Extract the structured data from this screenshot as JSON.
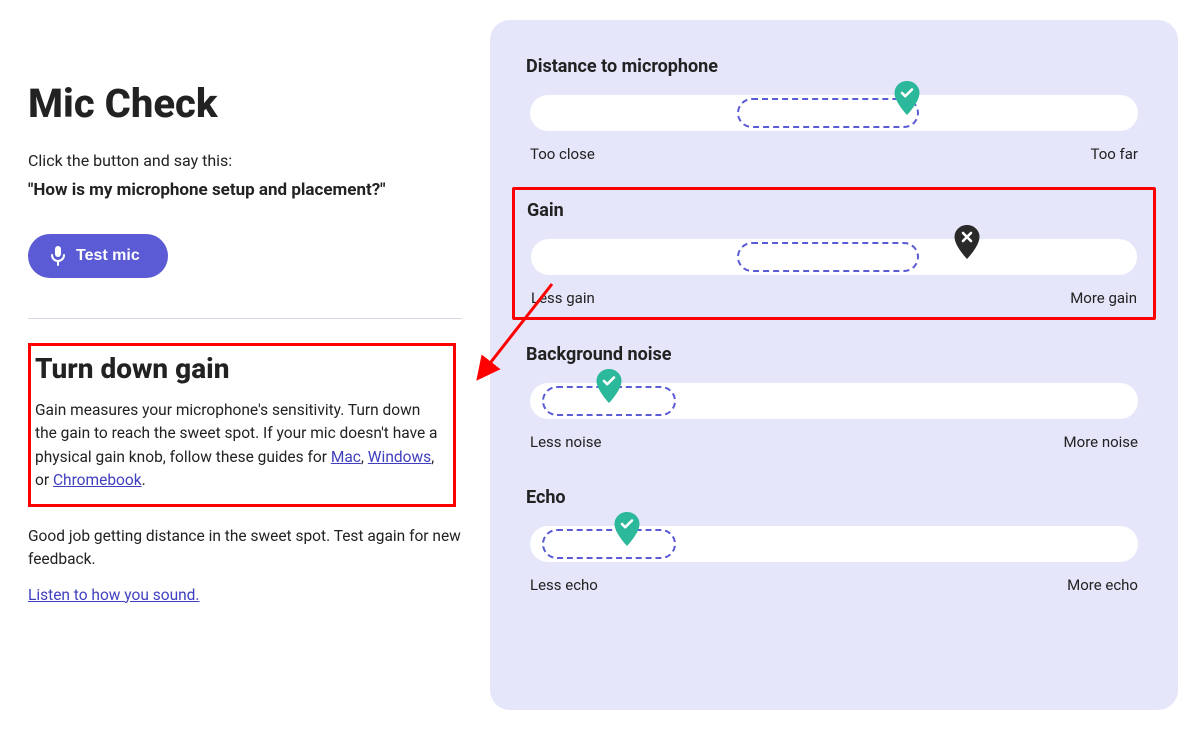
{
  "title": "Mic Check",
  "instruction": "Click the button and say this:",
  "prompt": "\"How is my microphone setup and placement?\"",
  "test_button": "Test mic",
  "advice": {
    "heading": "Turn down gain",
    "body_start": "Gain measures your microphone's sensitivity. Turn down the gain to reach the sweet spot. If your mic doesn't have a physical gain knob, follow these guides for ",
    "mac": "Mac",
    "sep1": ", ",
    "windows": "Windows",
    "sep2": ", or ",
    "chromebook": "Chromebook",
    "body_end": "."
  },
  "secondary": "Good job getting distance in the sweet spot. Test again for new feedback.",
  "listen_link": "Listen to how you sound.",
  "meters": {
    "distance": {
      "title": "Distance to microphone",
      "left": "Too close",
      "right": "Too far",
      "sweet_left_pct": 34,
      "sweet_width_pct": 30,
      "pin_pct": 62,
      "pin_state": "good"
    },
    "gain": {
      "title": "Gain",
      "left": "Less gain",
      "right": "More gain",
      "sweet_left_pct": 34,
      "sweet_width_pct": 30,
      "pin_pct": 72,
      "pin_state": "bad"
    },
    "noise": {
      "title": "Background noise",
      "left": "Less noise",
      "right": "More noise",
      "sweet_left_pct": 2,
      "sweet_width_pct": 22,
      "pin_pct": 13,
      "pin_state": "good"
    },
    "echo": {
      "title": "Echo",
      "left": "Less echo",
      "right": "More echo",
      "sweet_left_pct": 2,
      "sweet_width_pct": 22,
      "pin_pct": 16,
      "pin_state": "good"
    }
  },
  "colors": {
    "accent": "#5b5bd6",
    "panel": "#e6e6fb",
    "good_pin": "#2cb89a",
    "bad_pin": "#2a2a2a",
    "highlight": "#ff0000"
  }
}
